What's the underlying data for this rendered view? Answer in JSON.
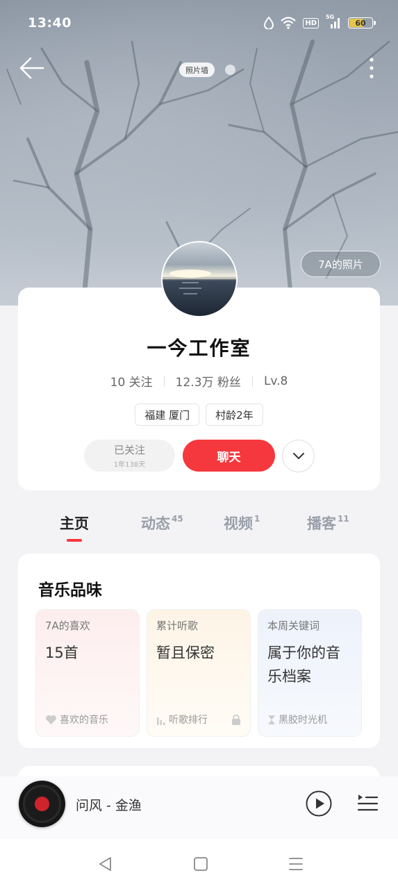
{
  "status_bar": {
    "time": "13:40",
    "hd_label": "HD",
    "network_label": "5G",
    "battery_level": "60"
  },
  "header": {
    "photo_wall_label": "照片墙",
    "photos_button_label": "7A的照片"
  },
  "profile": {
    "name": "一今工作室",
    "following": "10 关注",
    "fans": "12.3万 粉丝",
    "level": "Lv.8",
    "tags": [
      "福建 厦门",
      "村龄2年"
    ],
    "following_button_label": "已关注",
    "following_duration": "1年138天",
    "chat_button_label": "聊天"
  },
  "tabs": [
    {
      "label": "主页",
      "badge": ""
    },
    {
      "label": "动态",
      "badge": "45"
    },
    {
      "label": "视频",
      "badge": "1"
    },
    {
      "label": "播客",
      "badge": "11"
    }
  ],
  "music_taste": {
    "title": "音乐品味",
    "tiles": [
      {
        "label": "7A的喜欢",
        "value": "15首",
        "footer": "喜欢的音乐"
      },
      {
        "label": "累计听歌",
        "value": "暂且保密",
        "footer": "听歌排行"
      },
      {
        "label": "本周关键词",
        "value": "属于你的音乐档案",
        "footer": "黑胶时光机"
      }
    ]
  },
  "player": {
    "song": "问风 - 金渔"
  },
  "colors": {
    "accent": "#f5383d",
    "tile_pink": "#fdeeee",
    "tile_yellow": "#fdf4e6",
    "tile_blue": "#edf2fb"
  }
}
